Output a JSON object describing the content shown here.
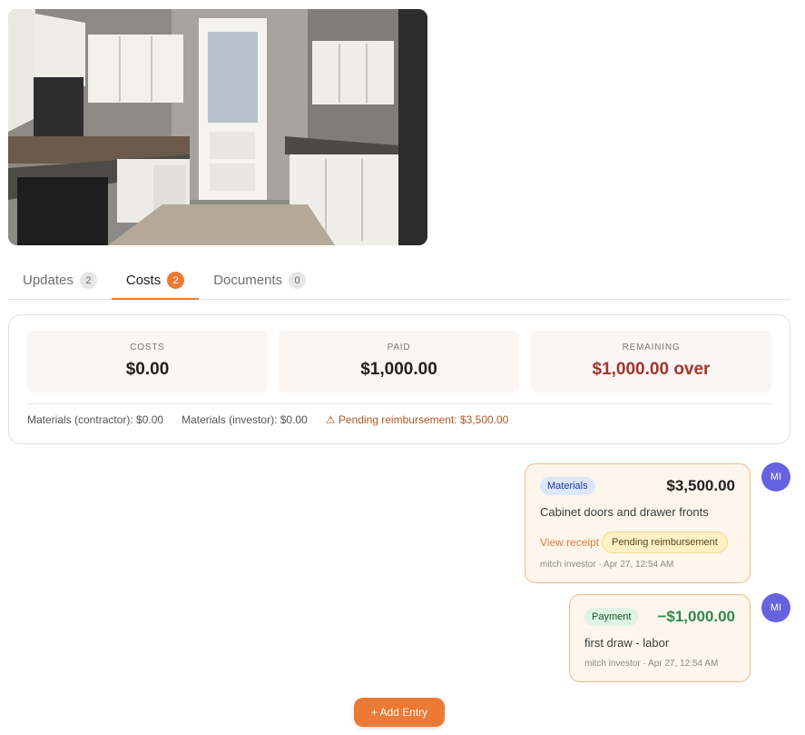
{
  "tabs": [
    {
      "label": "Updates",
      "count": "2"
    },
    {
      "label": "Costs",
      "count": "2"
    },
    {
      "label": "Documents",
      "count": "0"
    }
  ],
  "summary": {
    "costs_label": "COSTS",
    "costs_value": "$0.00",
    "paid_label": "PAID",
    "paid_value": "$1,000.00",
    "remaining_label": "REMAINING",
    "remaining_value": "$1,000.00 over",
    "materials_contractor": "Materials (contractor): $0.00",
    "materials_investor": "Materials (investor): $0.00",
    "pending": "⚠ Pending reimbursement: $3,500.00"
  },
  "entries": [
    {
      "category": "Materials",
      "amount": "$3,500.00",
      "description": "Cabinet doors and drawer fronts",
      "receipt_link": "View receipt",
      "status": "Pending reimbursement",
      "meta": "mitch investor · Apr 27, 12:54 AM",
      "avatar": "MI"
    },
    {
      "category": "Payment",
      "amount": "−$1,000.00",
      "description": "first draw - labor",
      "meta": "mitch investor · Apr 27, 12:54 AM",
      "avatar": "MI"
    }
  ],
  "add_entry_label": "+ Add Entry",
  "colors": {
    "accent": "#ec7a35",
    "over": "#a2342e",
    "payment_amount": "#2f8a4e",
    "avatar": "#6563e0"
  }
}
